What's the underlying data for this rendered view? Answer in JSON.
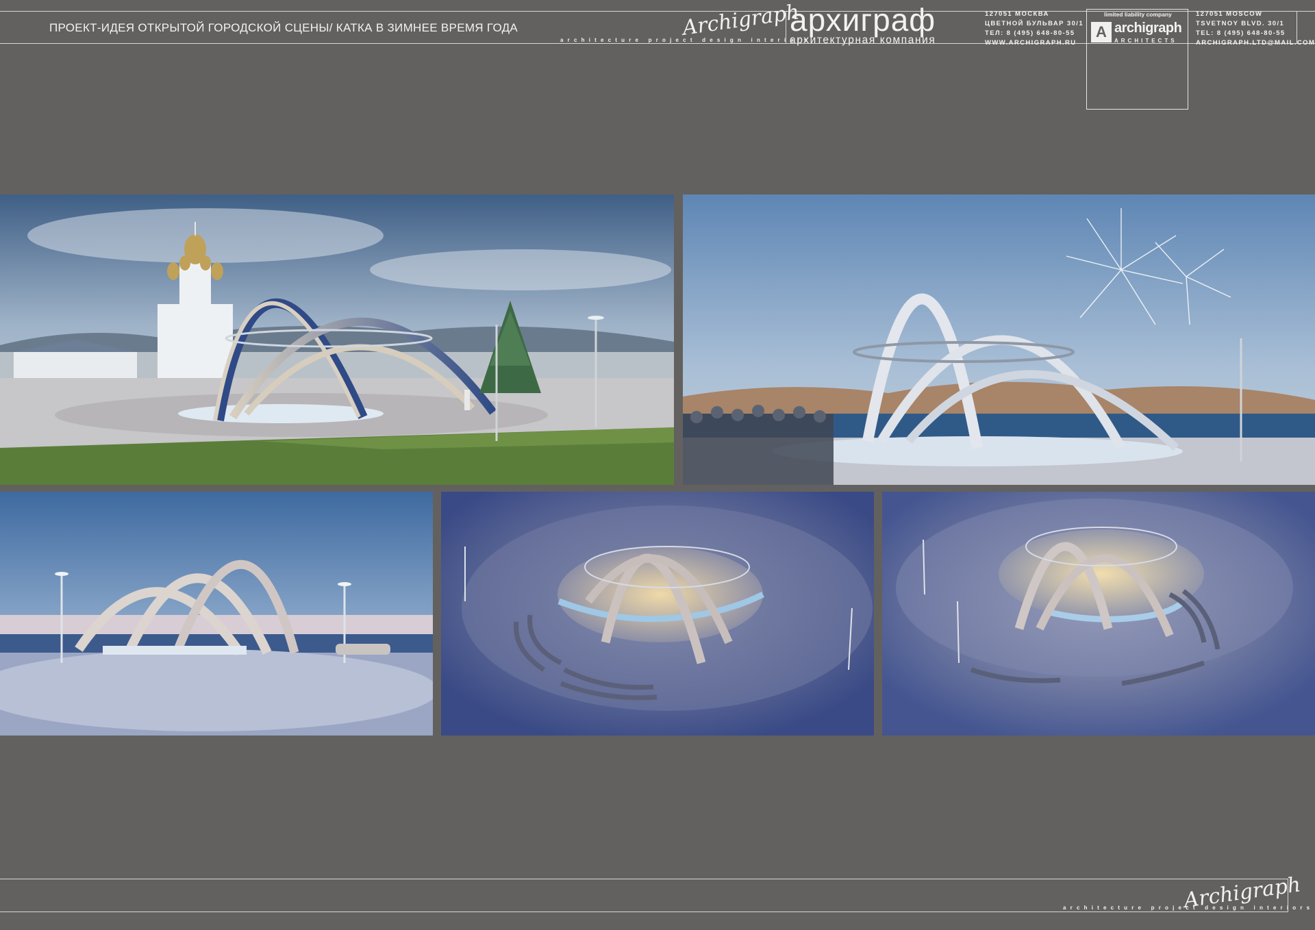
{
  "header": {
    "title": "ПРОЕКТ-ИДЕЯ ОТКРЫТОЙ ГОРОДСКОЙ СЦЕНЫ/ КАТКА В ЗИМНЕЕ ВРЕМЯ ГОДА",
    "signature": "Archigraph",
    "tagline": "architecture  project  design  interiors",
    "brand_ru": "архиграф",
    "brand_sub": "архитектурная компания",
    "address_ru": [
      "127051 МОСКВА",
      "ЦВЕТНОЙ БУЛЬВАР 30/1",
      "ТЕЛ: 8 (495) 648-80-55",
      "WWW.ARCHIGRAPH.RU"
    ],
    "address_en": [
      "127051 MOSCOW",
      "TSVETNOY BLVD. 30/1",
      "TEL: 8 (495) 648-80-55",
      "ARCHIGRAPH.LTD@MAIL.COM"
    ],
    "logo": {
      "top_text": "limited liability company",
      "name": "archigraph",
      "sub": "ARCHITECTS",
      "mark": "A"
    }
  },
  "footer": {
    "signature": "Archigraph",
    "tagline": "architecture  project  design  interiors"
  },
  "renders": [
    {
      "scene": "daytime-arches-cathedral-christmas-tree"
    },
    {
      "scene": "sea-view-arches-fireworks-crowd"
    },
    {
      "scene": "dusk-front-view-stage"
    },
    {
      "scene": "aerial-night-view-left"
    },
    {
      "scene": "aerial-night-view-right"
    }
  ],
  "colors": {
    "background": "#62615f",
    "rule": "#d8d8d8",
    "text": "#f2f2f2"
  }
}
